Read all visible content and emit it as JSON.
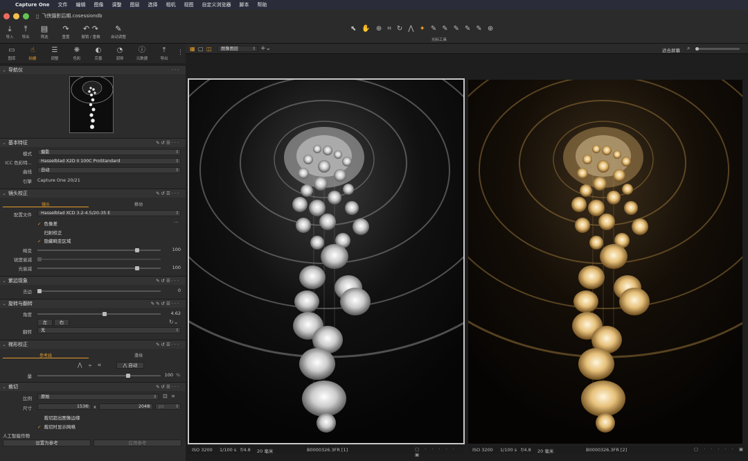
{
  "menubar": {
    "apple": "",
    "items": [
      "Capture One",
      "文件",
      "编辑",
      "图像",
      "调整",
      "图层",
      "选择",
      "相机",
      "视图",
      "自定义浏览器",
      "脚本",
      "帮助"
    ]
  },
  "window": {
    "title": "飞侠摄影后期.cosessiondb"
  },
  "toolbar": {
    "items": [
      {
        "icon": "import-icon",
        "glyph": "⤓",
        "label": "导入"
      },
      {
        "icon": "export-icon",
        "glyph": "⤒",
        "label": "导出"
      },
      {
        "icon": "filter-icon",
        "glyph": "▤",
        "label": "筛选"
      },
      {
        "icon": "redo-icon",
        "glyph": "↷",
        "label": "重置"
      },
      {
        "icon": "undo-icon",
        "glyph": "↶ ↷",
        "label": "撤销 / 重做"
      },
      {
        "icon": "auto-adjust-icon",
        "glyph": "✎",
        "label": "自动调整"
      }
    ],
    "cursor_label": "光标工具",
    "cursor_icons": [
      "⬉",
      "✋",
      "⊕",
      "⌗",
      "↻",
      "⋀",
      "✦",
      "✎",
      "✎",
      "✎",
      "✎",
      "✎",
      "⊕"
    ]
  },
  "tabs": [
    {
      "icon": "library-icon",
      "glyph": "▭",
      "label": "图库"
    },
    {
      "icon": "capture-icon",
      "glyph": "☝",
      "label": "拍摄",
      "active": true
    },
    {
      "icon": "adjust-icon",
      "glyph": "☰",
      "label": "调整"
    },
    {
      "icon": "color-icon",
      "glyph": "❋",
      "label": "色彩"
    },
    {
      "icon": "exposure-icon",
      "glyph": "◐",
      "label": "完善"
    },
    {
      "icon": "details-icon",
      "glyph": "◔",
      "label": "润饰"
    },
    {
      "icon": "metadata-icon",
      "glyph": "ⓘ",
      "label": "元数据"
    },
    {
      "icon": "output-icon",
      "glyph": "⤒",
      "label": "导出"
    }
  ],
  "navigator": {
    "title": "导航仪"
  },
  "basic": {
    "title": "基本特征",
    "rows": [
      {
        "label": "模式",
        "value": "摄影"
      },
      {
        "label": "ICC 色彩特...",
        "value": "Hasselblad X2D II 100C ProStandard"
      },
      {
        "label": "曲线",
        "value": "自动"
      }
    ],
    "engine_label": "引擎",
    "engine_value": "Capture One 20/21"
  },
  "lens": {
    "title": "镜头校正",
    "subtabs": [
      "镜头",
      "移动"
    ],
    "profile_label": "配置文件",
    "profile_value": "Hasselblad XCD 3.2-4.5/20-35 E",
    "checks": [
      {
        "checked": true,
        "label": "色像差"
      },
      {
        "checked": false,
        "label": "扫射校正"
      },
      {
        "checked": true,
        "label": "隐藏畸变区域"
      }
    ],
    "sliders": [
      {
        "label": "畸变",
        "value": "100",
        "pos": 0.98
      },
      {
        "label": "锐度衰减",
        "value": "",
        "pos": 0.0
      },
      {
        "label": "光衰减",
        "value": "100",
        "pos": 0.98
      }
    ]
  },
  "vignette": {
    "title": "紫边现象",
    "slider_label": "去边",
    "value": "0"
  },
  "rotation": {
    "title": "旋转与翻转",
    "angle_label": "角度",
    "angle_value": "4.62",
    "left": "左",
    "right": "右",
    "flip_label": "翻转",
    "flip_value": "无"
  },
  "keystone": {
    "title": "梯形校正",
    "subtabs": [
      "参考线",
      "滑块"
    ],
    "auto": "自动",
    "amount_label": "量",
    "amount_value": "100",
    "unit": "%"
  },
  "crop": {
    "title": "裁切",
    "ratio_label": "比例",
    "ratio_value": "原始",
    "size_label": "尺寸",
    "width": "1536",
    "x": "x",
    "height": "2048",
    "unit": "px",
    "checks": [
      {
        "checked": false,
        "label": "裁切超出图像边缘"
      },
      {
        "checked": true,
        "label": "裁切时显示网格"
      }
    ]
  },
  "ai": {
    "title": "人工智能作物",
    "set_ref": "设置为参考",
    "apply_ref": "应用参考"
  },
  "viewer": {
    "layer_dropdown": "图像图层",
    "fit": "适合屏幕",
    "left": {
      "iso": "ISO 3200",
      "shutter": "1/100 s",
      "aperture": "f/4.8",
      "focal": "20 毫米",
      "file": "B0000326.3FR [1]"
    },
    "right": {
      "iso": "ISO 3200",
      "shutter": "1/100 s",
      "aperture": "f/4.8",
      "focal": "20 毫米",
      "file": "B0000326.3FR [2]"
    }
  }
}
